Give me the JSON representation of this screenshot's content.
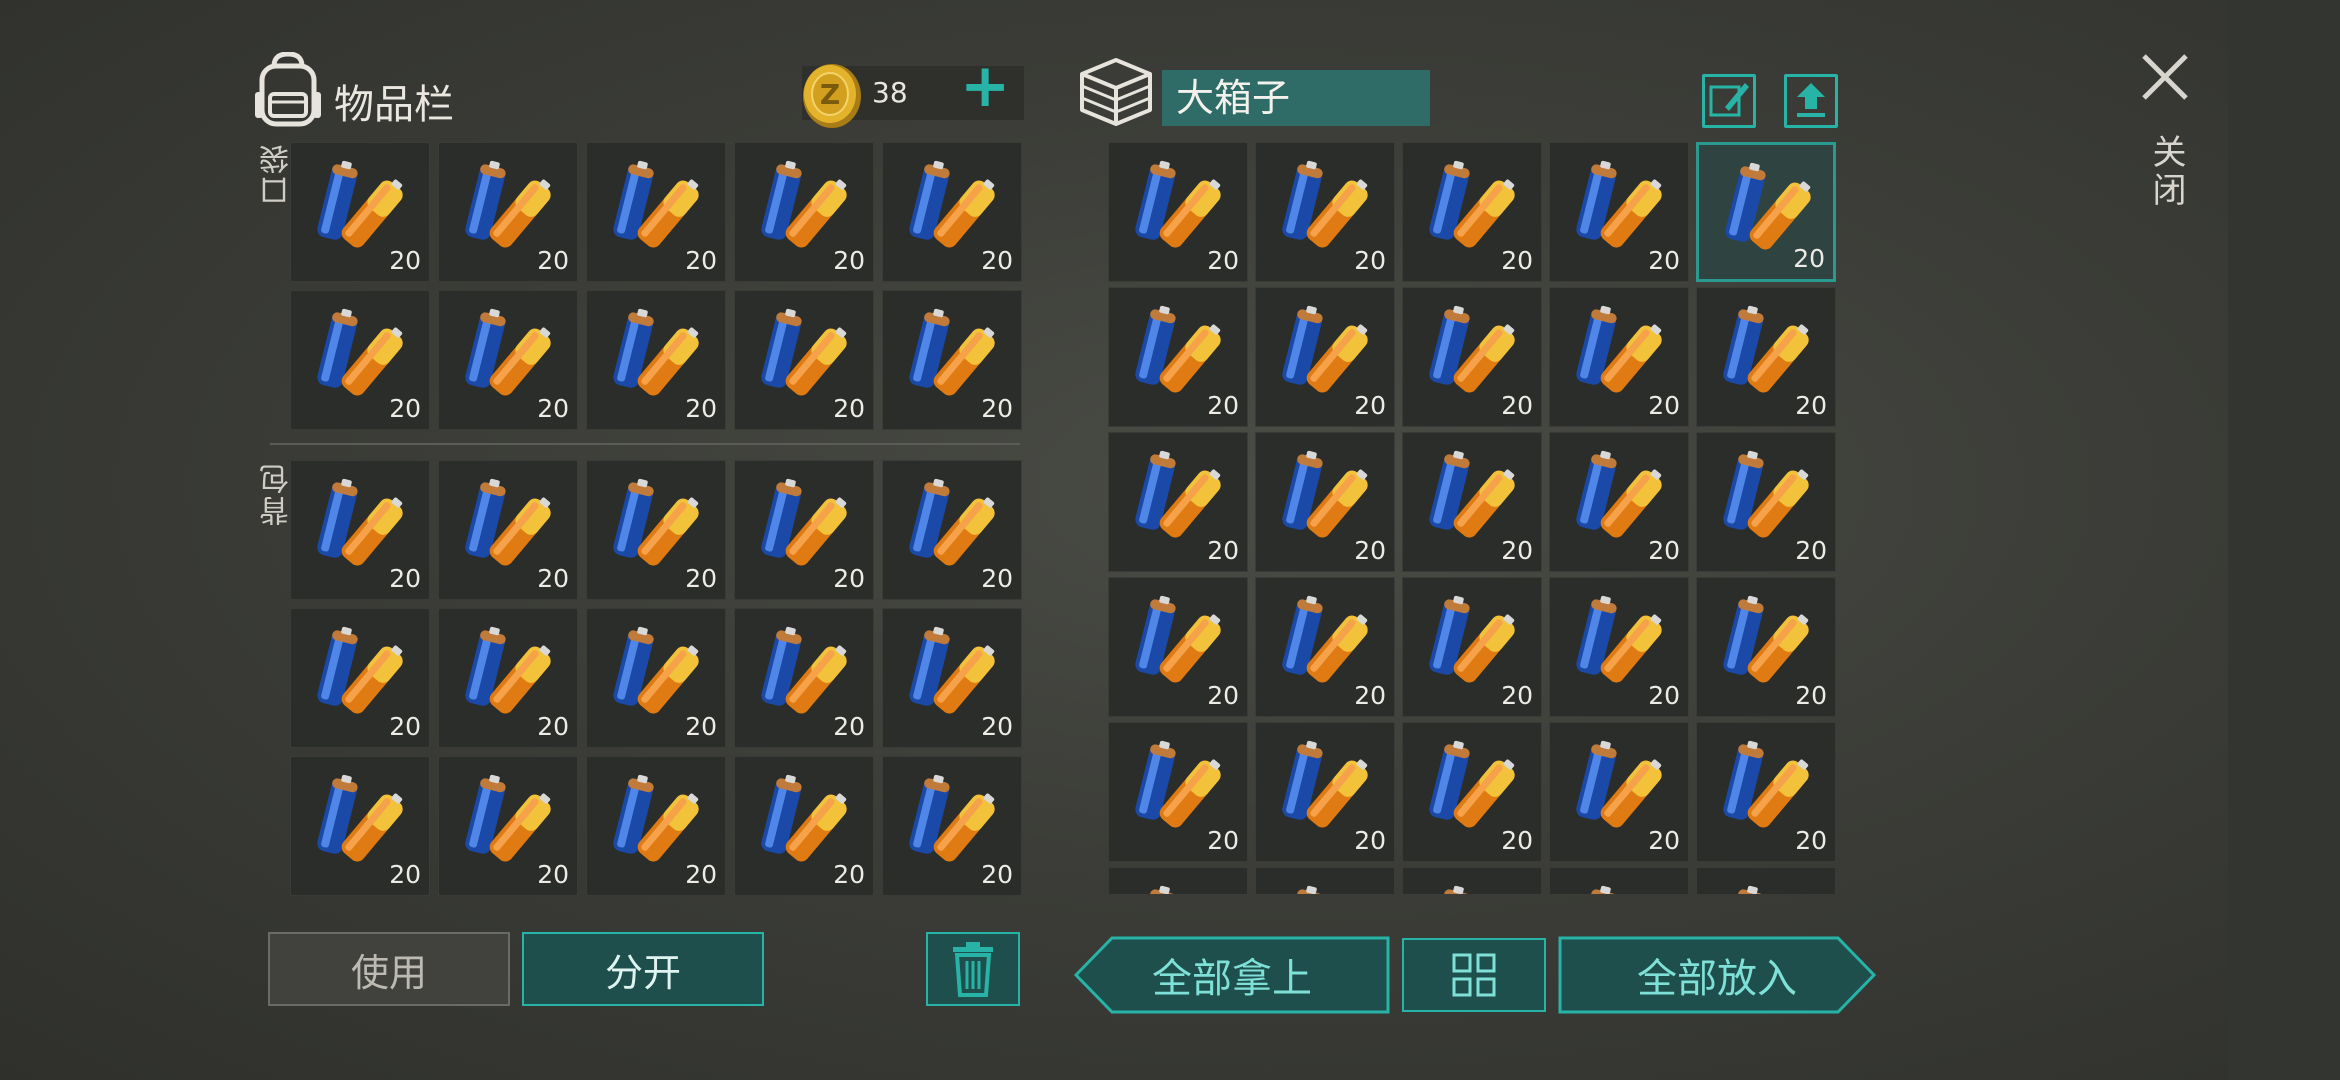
{
  "inventory": {
    "title": "物品栏",
    "coins": "38",
    "plus": "+",
    "pocket_label": "口袋",
    "backpack_label": "背包",
    "pocket_slots": [
      {
        "count": "20"
      },
      {
        "count": "20"
      },
      {
        "count": "20"
      },
      {
        "count": "20"
      },
      {
        "count": "20"
      },
      {
        "count": "20"
      },
      {
        "count": "20"
      },
      {
        "count": "20"
      },
      {
        "count": "20"
      },
      {
        "count": "20"
      }
    ],
    "backpack_slots": [
      {
        "count": "20"
      },
      {
        "count": "20"
      },
      {
        "count": "20"
      },
      {
        "count": "20"
      },
      {
        "count": "20"
      },
      {
        "count": "20"
      },
      {
        "count": "20"
      },
      {
        "count": "20"
      },
      {
        "count": "20"
      },
      {
        "count": "20"
      },
      {
        "count": "20"
      },
      {
        "count": "20"
      },
      {
        "count": "20"
      },
      {
        "count": "20"
      },
      {
        "count": "20"
      }
    ]
  },
  "container": {
    "name": "大箱子",
    "slots": [
      {
        "count": "20"
      },
      {
        "count": "20"
      },
      {
        "count": "20"
      },
      {
        "count": "20"
      },
      {
        "count": "20",
        "selected": true
      },
      {
        "count": "20"
      },
      {
        "count": "20"
      },
      {
        "count": "20"
      },
      {
        "count": "20"
      },
      {
        "count": "20"
      },
      {
        "count": "20"
      },
      {
        "count": "20"
      },
      {
        "count": "20"
      },
      {
        "count": "20"
      },
      {
        "count": "20"
      },
      {
        "count": "20"
      },
      {
        "count": "20"
      },
      {
        "count": "20"
      },
      {
        "count": "20"
      },
      {
        "count": "20"
      },
      {
        "count": "20"
      },
      {
        "count": "20"
      },
      {
        "count": "20"
      },
      {
        "count": "20"
      },
      {
        "count": "20"
      },
      {
        "count": ""
      },
      {
        "count": ""
      },
      {
        "count": ""
      },
      {
        "count": ""
      },
      {
        "count": ""
      }
    ]
  },
  "close_label": "关闭",
  "buttons": {
    "use": "使用",
    "split": "分开",
    "take_all": "全部拿上",
    "put_all": "全部放入"
  },
  "icons": {
    "backpack": "backpack-icon",
    "coin": "coin-icon",
    "box": "box-icon",
    "rename": "edit-brush-icon",
    "upload": "upload-icon",
    "close": "close-icon",
    "trash": "trash-icon",
    "sort": "grid-sort-icon",
    "item": "battery-item-icon"
  },
  "colors": {
    "accent": "#27b3a6",
    "accent_dark": "#1f4f4c",
    "slot_bg": "#2b2d2a",
    "name_field": "#2f6b67"
  }
}
